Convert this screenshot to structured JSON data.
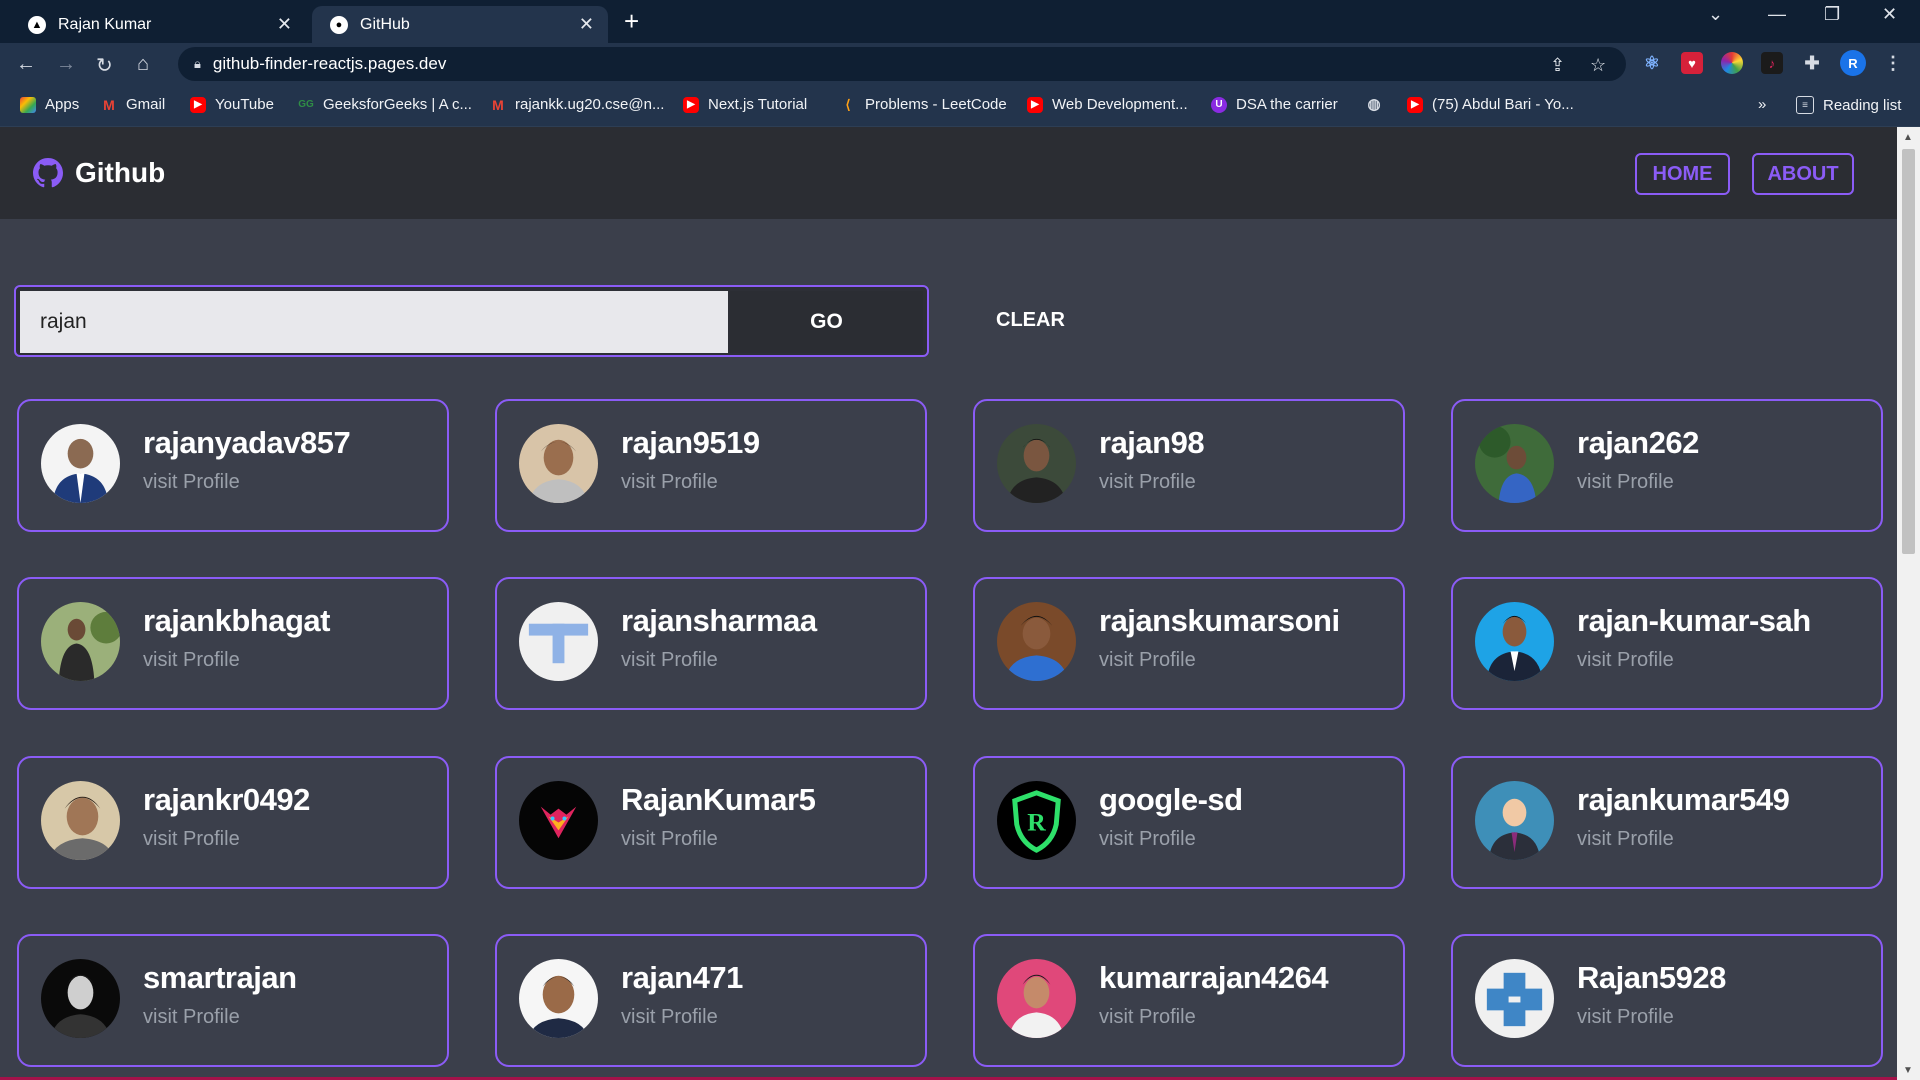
{
  "browser": {
    "tabs": [
      {
        "title": "Rajan Kumar",
        "active": false
      },
      {
        "title": "GitHub",
        "active": true
      }
    ],
    "url": "github-finder-reactjs.pages.dev",
    "bookmarks": [
      {
        "label": "Apps",
        "icon": "apps-grid-icon"
      },
      {
        "label": "Gmail",
        "icon": "gmail-icon"
      },
      {
        "label": "YouTube",
        "icon": "youtube-icon"
      },
      {
        "label": "GeeksforGeeks | A c...",
        "icon": "gfg-icon"
      },
      {
        "label": "rajankk.ug20.cse@n...",
        "icon": "gmail-icon"
      },
      {
        "label": "Next.js Tutorial",
        "icon": "youtube-icon"
      },
      {
        "label": "Problems - LeetCode",
        "icon": "leetcode-icon"
      },
      {
        "label": "Web Development...",
        "icon": "youtube-icon"
      },
      {
        "label": "DSA the carrier",
        "icon": "dsa-icon"
      },
      {
        "label": "",
        "icon": "globe-icon"
      },
      {
        "label": "(75) Abdul Bari - Yo...",
        "icon": "youtube-icon"
      }
    ],
    "reading_list": "Reading list",
    "profile_initial": "R"
  },
  "app": {
    "title": "Github",
    "nav": {
      "home": "HOME",
      "about": "ABOUT"
    },
    "search": {
      "value": "rajan",
      "go_label": "GO",
      "clear_label": "CLEAR"
    },
    "visit_label": "visit Profile",
    "accent_color": "#8b5cf6",
    "users": [
      {
        "login": "rajanyadav857"
      },
      {
        "login": "rajan9519"
      },
      {
        "login": "rajan98"
      },
      {
        "login": "rajan262"
      },
      {
        "login": "rajankbhagat"
      },
      {
        "login": "rajansharmaa"
      },
      {
        "login": "rajanskumarsoni"
      },
      {
        "login": "rajan-kumar-sah"
      },
      {
        "login": "rajankr0492"
      },
      {
        "login": "RajanKumar5"
      },
      {
        "login": "google-sd"
      },
      {
        "login": "rajankumar549"
      },
      {
        "login": "smartrajan"
      },
      {
        "login": "rajan471"
      },
      {
        "login": "kumarrajan4264"
      },
      {
        "login": "Rajan5928"
      }
    ]
  }
}
